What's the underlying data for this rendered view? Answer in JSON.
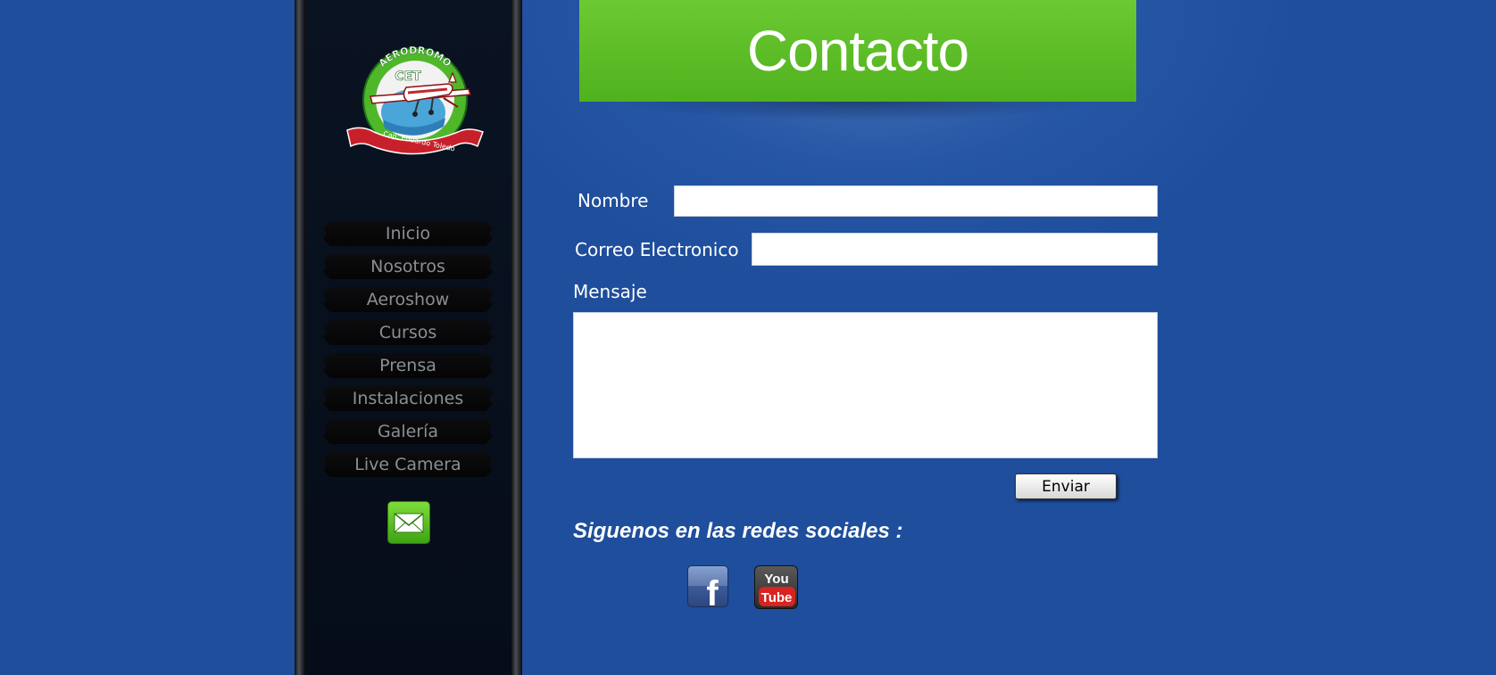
{
  "sidebar": {
    "logo": {
      "top_text": "AERODROMO",
      "mid_text": "CET",
      "ribbon_text": "Cap. Eduardo Toledo"
    },
    "nav": [
      {
        "label": "Inicio"
      },
      {
        "label": "Nosotros"
      },
      {
        "label": "Aeroshow"
      },
      {
        "label": "Cursos"
      },
      {
        "label": "Prensa"
      },
      {
        "label": "Instalaciones"
      },
      {
        "label": "Galería"
      },
      {
        "label": "Live Camera"
      }
    ],
    "mail_icon": "envelope-icon"
  },
  "header": {
    "title": "Contacto"
  },
  "form": {
    "name_label": "Nombre",
    "name_value": "",
    "email_label": "Correo Electronico",
    "email_value": "",
    "message_label": "Mensaje",
    "message_value": "",
    "submit_label": "Enviar"
  },
  "social": {
    "title": "Siguenos en las redes sociales :",
    "facebook_glyph": "f",
    "youtube_you": "You",
    "youtube_tube": "Tube"
  },
  "colors": {
    "background": "#1e4e9c",
    "header_green": "#5cbd26",
    "sidebar": "#07101c",
    "nav_text": "#8b8e93"
  }
}
